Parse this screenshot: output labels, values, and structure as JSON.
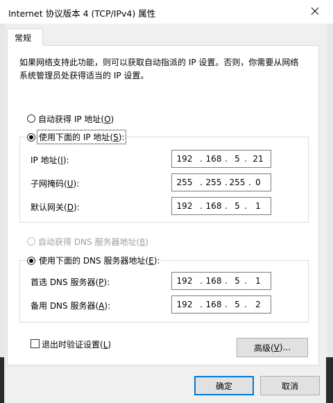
{
  "window": {
    "title": "Internet 协议版本 4 (TCP/IPv4) 属性"
  },
  "tabs": [
    {
      "label": "常规"
    }
  ],
  "description": "如果网络支持此功能，则可以获取自动指派的 IP 设置。否则，你需要从网络系统管理员处获得适当的 IP 设置。",
  "ip_section": {
    "auto_option": {
      "text": "自动获得 IP 地址(",
      "key": "O",
      "end": ")",
      "checked": false
    },
    "manual_option": {
      "text": "使用下面的 IP 地址(",
      "key": "S",
      "end": "):",
      "checked": true
    },
    "fields": [
      {
        "label": "IP 地址(",
        "key": "I",
        "end": "):",
        "octets": [
          "192",
          "168",
          "5",
          "21"
        ]
      },
      {
        "label": "子网掩码(",
        "key": "U",
        "end": "):",
        "octets": [
          "255",
          "255",
          "255",
          "0"
        ]
      },
      {
        "label": "默认网关(",
        "key": "D",
        "end": "):",
        "octets": [
          "192",
          "168",
          "5",
          "1"
        ]
      }
    ]
  },
  "dns_section": {
    "auto_option": {
      "text": "自动获得 DNS 服务器地址(",
      "key": "B",
      "end": ")",
      "checked": false,
      "disabled": true
    },
    "manual_option": {
      "text": "使用下面的 DNS 服务器地址(",
      "key": "E",
      "end": "):",
      "checked": true
    },
    "fields": [
      {
        "label": "首选 DNS 服务器(",
        "key": "P",
        "end": "):",
        "octets": [
          "192",
          "168",
          "5",
          "1"
        ]
      },
      {
        "label": "备用 DNS 服务器(",
        "key": "A",
        "end": "):",
        "octets": [
          "192",
          "168",
          "5",
          "2"
        ]
      }
    ]
  },
  "validate_on_exit": {
    "text": "退出时验证设置(",
    "key": "L",
    "end": ")",
    "checked": false
  },
  "buttons": {
    "advanced": {
      "text": "高级(",
      "key": "V",
      "end": ")..."
    },
    "ok": "确定",
    "cancel": "取消"
  }
}
